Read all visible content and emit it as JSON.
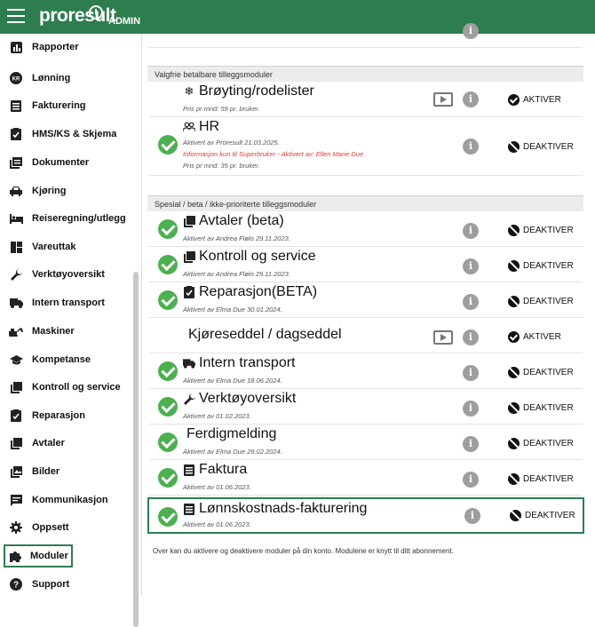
{
  "header": {
    "logo": "proresult",
    "admin_label": "ADMIN"
  },
  "sidebar": {
    "items": [
      {
        "label": "Rapporter",
        "icon": "bar-chart-icon"
      },
      {
        "label": "Lønning",
        "icon": "kr-icon"
      },
      {
        "label": "Fakturering",
        "icon": "document-icon"
      },
      {
        "label": "HMS/KS & Skjema",
        "icon": "clipboard-check-icon"
      },
      {
        "label": "Dokumenter",
        "icon": "documents-icon"
      },
      {
        "label": "Kjøring",
        "icon": "car-icon"
      },
      {
        "label": "Reiseregning/utlegg",
        "icon": "bed-icon"
      },
      {
        "label": "Vareuttak",
        "icon": "grid-icon"
      },
      {
        "label": "Verktøyoversikt",
        "icon": "wrench-icon"
      },
      {
        "label": "Intern transport",
        "icon": "truck-icon"
      },
      {
        "label": "Maskiner",
        "icon": "excavator-icon"
      },
      {
        "label": "Kompetanse",
        "icon": "graduation-cap-icon"
      },
      {
        "label": "Kontroll og service",
        "icon": "library-icon"
      },
      {
        "label": "Reparasjon",
        "icon": "clipboard-check-icon"
      },
      {
        "label": "Avtaler",
        "icon": "library-icon"
      },
      {
        "label": "Bilder",
        "icon": "image-icon"
      },
      {
        "label": "Kommunikasjon",
        "icon": "chat-icon"
      },
      {
        "label": "Oppsett",
        "icon": "gear-icon"
      },
      {
        "label": "Moduler",
        "icon": "puzzle-icon",
        "active": true
      },
      {
        "label": "Support",
        "icon": "help-icon"
      }
    ]
  },
  "sections": {
    "paid": "Valgfrie betalbare tilleggsmoduler",
    "beta": "Spesial / beta / ikke-prioriterte tilleggsmoduler"
  },
  "actions": {
    "activate": "AKTIVER",
    "deactivate": "DEAKTIVER"
  },
  "modules": [
    {
      "title": "Brøyting/rodelister",
      "icon": "snowflake-icon",
      "sub1": "Pris pr mnd: 59 pr. bruker.",
      "active": false,
      "video": true
    },
    {
      "title": "HR",
      "icon": "people-icon",
      "sub1": "Aktivert av Proresult 21.03.2025.",
      "sub2": "Informasjon kun til Superbruker - Aktivert av: Ellen Marie Due",
      "sub3": "Pris pr mnd: 35 pr. bruker.",
      "active": true
    },
    {
      "title": "Avtaler (beta)",
      "icon": "library-icon",
      "sub1": "Aktivert av Andrea Flølo 29.11.2023.",
      "active": true
    },
    {
      "title": "Kontroll og service",
      "icon": "library-icon",
      "sub1": "Aktivert av Andrea Flølo 29.11.2023.",
      "active": true
    },
    {
      "title": "Reparasjon(BETA)",
      "icon": "clipboard-check-icon",
      "sub1": "Aktivert av Elma Due 30.01.2024.",
      "active": true
    },
    {
      "title": "Kjøreseddel / dagseddel",
      "icon": "",
      "sub1": "",
      "active": false,
      "video": true
    },
    {
      "title": "Intern transport",
      "icon": "truck-icon",
      "sub1": "Aktivert av Elma Due 18.06.2024.",
      "active": true
    },
    {
      "title": "Verktøyoversikt",
      "icon": "wrench-icon",
      "sub1": "Aktivert av 01.02.2023.",
      "active": true
    },
    {
      "title": "Ferdigmelding",
      "icon": "",
      "sub1": "Aktivert av Elma Due 29.02.2024.",
      "active": true
    },
    {
      "title": "Faktura",
      "icon": "document-icon",
      "sub1": "Aktivert av 01.06.2023.",
      "active": true
    },
    {
      "title": "Lønnskostnads-fakturering",
      "icon": "document-icon",
      "sub1": "Aktivert av 01.06.2023.",
      "active": true
    }
  ],
  "footer": "Over kan du aktivere og deaktivere moduler på din konto. Modulene er knytt til ditt abonnement."
}
